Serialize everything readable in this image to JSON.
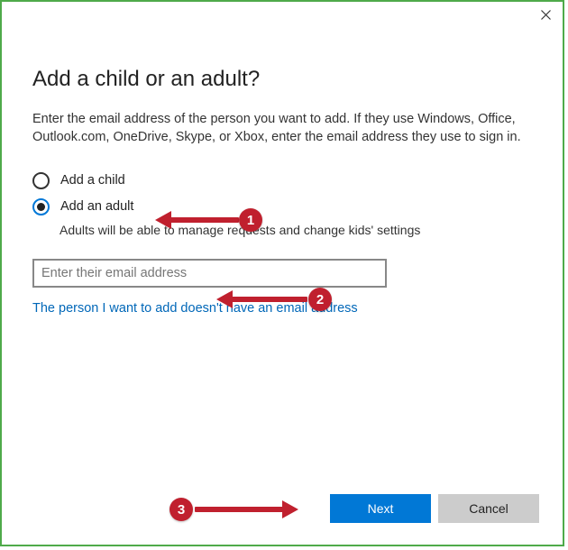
{
  "dialog": {
    "title": "Add a child or an adult?",
    "description": "Enter the email address of the person you want to add. If they use Windows, Office, Outlook.com, OneDrive, Skype, or Xbox, enter the email address they use to sign in.",
    "radio_child": "Add a child",
    "radio_adult": "Add an adult",
    "adult_sub": "Adults will be able to manage requests and change kids' settings",
    "email_placeholder": "Enter their email address",
    "no_email_link": "The person I want to add doesn't have an email address",
    "next_label": "Next",
    "cancel_label": "Cancel"
  },
  "annotations": {
    "badge1": "1",
    "badge2": "2",
    "badge3": "3"
  }
}
